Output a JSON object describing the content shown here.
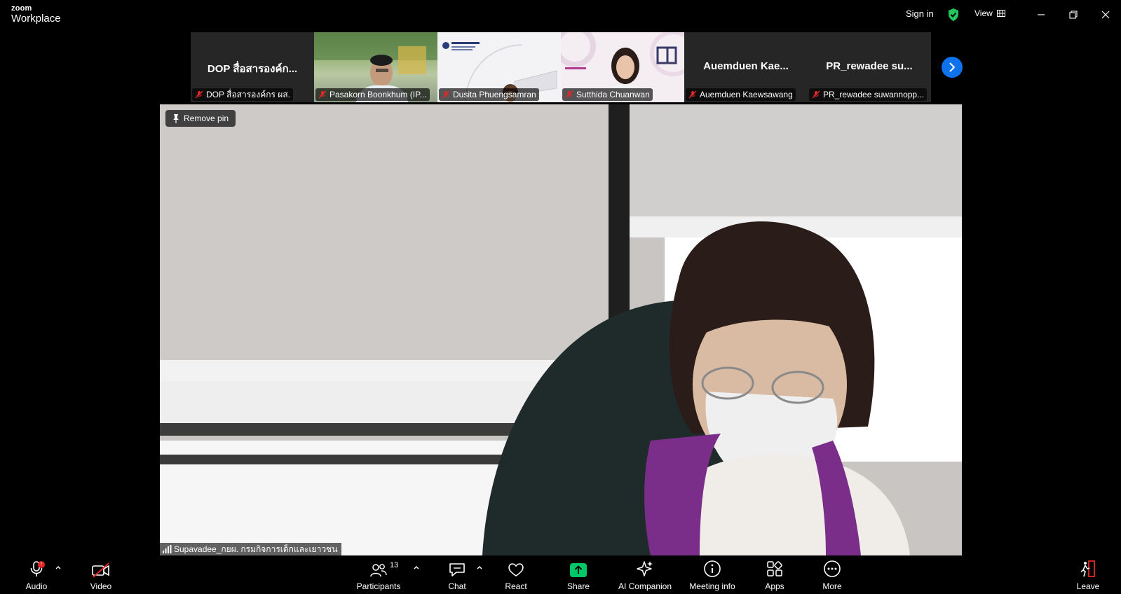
{
  "app": {
    "logo_top": "zoom",
    "logo_bottom": "Workplace"
  },
  "titlebar": {
    "sign_in": "Sign in",
    "view": "View"
  },
  "colors": {
    "accent": "#0e72ed",
    "secure": "#22c55e",
    "danger": "#e02828",
    "share": "#00c767"
  },
  "thumbnails": [
    {
      "display_name": "DOP สื่อสารองค์ก...",
      "label": "DOP สื่อสารองค์กร ผส.",
      "has_video": false
    },
    {
      "display_name": "",
      "label": "Pasakorn Boonkhum (IP...",
      "has_video": true
    },
    {
      "display_name": "",
      "label": "Dusita Phuengsamran",
      "has_video": true
    },
    {
      "display_name": "",
      "label": "Sutthida Chuanwan",
      "has_video": true
    },
    {
      "display_name": "Auemduen  Kae...",
      "label": "Auemduen Kaewsawang",
      "has_video": false
    },
    {
      "display_name": "PR_rewadee  su...",
      "label": "PR_rewadee suwannopp...",
      "has_video": false
    }
  ],
  "main": {
    "remove_pin": "Remove pin",
    "speaker": "Supavadee_กยผ. กรมกิจการเด็กและเยาวชน"
  },
  "toolbar": {
    "audio": "Audio",
    "video": "Video",
    "participants": "Participants",
    "participants_count": "13",
    "chat": "Chat",
    "react": "React",
    "share": "Share",
    "ai_companion": "AI Companion",
    "meeting_info": "Meeting info",
    "apps": "Apps",
    "more": "More",
    "leave": "Leave",
    "audio_alert": "!"
  }
}
